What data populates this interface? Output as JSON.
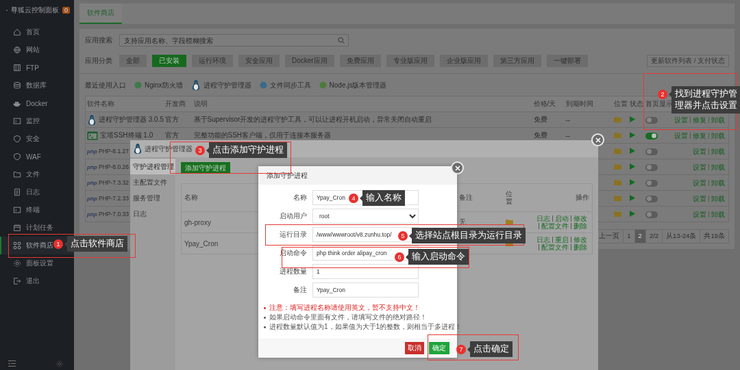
{
  "sidebar": {
    "title": "尊狐云控制面板",
    "badge": "0",
    "items": [
      {
        "label": "首页",
        "selected": false
      },
      {
        "label": "网站",
        "selected": false
      },
      {
        "label": "FTP",
        "selected": false
      },
      {
        "label": "数据库",
        "selected": false
      },
      {
        "label": "Docker",
        "selected": false
      },
      {
        "label": "监控",
        "selected": false
      },
      {
        "label": "安全",
        "selected": false
      },
      {
        "label": "WAF",
        "selected": false
      },
      {
        "label": "文件",
        "selected": false
      },
      {
        "label": "日志",
        "selected": false
      },
      {
        "label": "终端",
        "selected": false
      },
      {
        "label": "计划任务",
        "selected": false
      },
      {
        "label": "软件商店",
        "selected": true
      },
      {
        "label": "面板设置",
        "selected": false
      },
      {
        "label": "退出",
        "selected": false
      }
    ]
  },
  "tabs": [
    {
      "label": "软件商店",
      "selected": true
    }
  ],
  "search": {
    "label": "应用搜索",
    "placeholder": "支持应用名称、字段模糊搜索"
  },
  "categories": {
    "label": "应用分类",
    "items": [
      {
        "label": "全部",
        "selected": false
      },
      {
        "label": "已安装",
        "selected": true
      },
      {
        "label": "运行环境",
        "selected": false
      },
      {
        "label": "安全应用",
        "selected": false
      },
      {
        "label": "Docker应用",
        "selected": false
      },
      {
        "label": "免费应用",
        "selected": false
      },
      {
        "label": "专业版应用",
        "selected": false
      },
      {
        "label": "企业版应用",
        "selected": false
      },
      {
        "label": "第三方应用",
        "selected": false
      },
      {
        "label": "一键部署",
        "selected": false
      }
    ]
  },
  "refresh_button": "更新软件列表 / 支付状态",
  "recent": {
    "label": "最近使用入口",
    "items": [
      {
        "label": "Nginx防火墙"
      },
      {
        "label": "进程守护管理器"
      },
      {
        "label": "文件同步工具"
      },
      {
        "label": "Node.js版本管理器"
      }
    ]
  },
  "table": {
    "columns": [
      "软件名称",
      "开发商",
      "说明",
      "价格/天",
      "到期时间",
      "位置",
      "状态",
      "首页显示"
    ],
    "rows": [
      {
        "kind": "linux",
        "name": "进程守护管理器 3.0.5",
        "developer": "官方",
        "description": "基于Supervisor开发的进程守护工具，可以让进程开机启动，异常关闭自动重启",
        "price": "免费",
        "expiry": "--",
        "home_display": false,
        "actions": [
          "设置",
          "修复",
          "卸载"
        ]
      },
      {
        "kind": "terminal",
        "name": "宝塔SSH终端 1.0",
        "developer": "官方",
        "description": "完整功能的SSH客户端，仅用于连接本服务器",
        "price": "免费",
        "expiry": "--",
        "home_display": true,
        "actions": [
          "设置",
          "修复",
          "卸载"
        ]
      },
      {
        "kind": "php",
        "logo": "php",
        "name": "PHP-8.1.27",
        "home_display": false,
        "actions": [
          "设置",
          "卸载"
        ]
      },
      {
        "kind": "php",
        "logo": "php",
        "name": "PHP-8.0.26",
        "home_display": false,
        "actions": [
          "设置",
          "卸载"
        ]
      },
      {
        "kind": "php",
        "logo": "php",
        "name": "PHP-7.3.32",
        "home_display": false,
        "actions": [
          "设置",
          "卸载"
        ]
      },
      {
        "kind": "php",
        "logo": "php",
        "name": "PHP-7.2.33",
        "home_display": false,
        "actions": [
          "设置",
          "卸载"
        ]
      },
      {
        "kind": "php",
        "logo": "php",
        "name": "PHP-7.0.33",
        "home_display": false,
        "actions": [
          "设置",
          "卸载"
        ]
      }
    ]
  },
  "pagination": [
    {
      "label": "上一页",
      "selected": false
    },
    {
      "label": "1",
      "selected": false
    },
    {
      "label": "2",
      "selected": true
    },
    {
      "label": "2/2",
      "selected": false
    },
    {
      "label": "从13-24条",
      "selected": false
    },
    {
      "label": "共19条",
      "selected": false
    }
  ],
  "manager_dialog": {
    "title": "进程守护管理器",
    "nav": [
      {
        "label": "守护进程管理",
        "selected": true
      },
      {
        "label": "主配置文件",
        "selected": false
      },
      {
        "label": "服务管理",
        "selected": false
      },
      {
        "label": "日志",
        "selected": false
      }
    ],
    "add_button": "添加守护进程",
    "columns": {
      "name": "名称",
      "remark": "备注",
      "location": "位置",
      "actions": "操作"
    },
    "rows": [
      {
        "name": "gh-proxy",
        "remark": "无",
        "actions": [
          "日志",
          "启动",
          "修改",
          "配置文件",
          "删除"
        ]
      },
      {
        "name": "Ypay_Cron",
        "actions": [
          "日志",
          "重启",
          "修改",
          "配置文件",
          "删除"
        ]
      }
    ]
  },
  "add_dialog": {
    "title": "添加守护进程",
    "fields": [
      {
        "kind": "input",
        "label": "名称",
        "value": "Ypay_Cron"
      },
      {
        "kind": "select",
        "label": "启动用户",
        "value": "root"
      },
      {
        "kind": "input",
        "label": "运行目录",
        "value": "/www/wwwroot/v8.zunhu.top/"
      },
      {
        "kind": "input",
        "label": "启动命令",
        "value": "php think order alipay_cron"
      },
      {
        "kind": "input",
        "label": "进程数量",
        "value": "1"
      },
      {
        "kind": "input",
        "label": "备注",
        "value": "Ypay_Cron"
      }
    ],
    "notes": [
      {
        "text": "注意：填写进程名称请使用英文，暂不支持中文！",
        "warning": true
      },
      {
        "text": "如果启动命令里面有文件，请填写文件的绝对路径！",
        "warning": false
      },
      {
        "text": "进程数量默认值为1，如果值为大于1的整数，则相当于多进程！",
        "warning": false
      }
    ],
    "cancel": "取消",
    "confirm": "确定"
  },
  "callouts": [
    {
      "number": "1",
      "text": "点击软件商店",
      "framed": true
    },
    {
      "number": "2",
      "text": "找到进程守护管理器并点击设置",
      "framed": true
    },
    {
      "number": "3",
      "text": "点击添加守护进程",
      "framed": true
    },
    {
      "number": "4",
      "text": "输入名称",
      "framed": false
    },
    {
      "number": "5",
      "text": "选择站点根目录为运行目录",
      "framed": true
    },
    {
      "number": "6",
      "text": "输入启动命令",
      "framed": true
    },
    {
      "number": "7",
      "text": "点击确定",
      "framed": true
    }
  ]
}
